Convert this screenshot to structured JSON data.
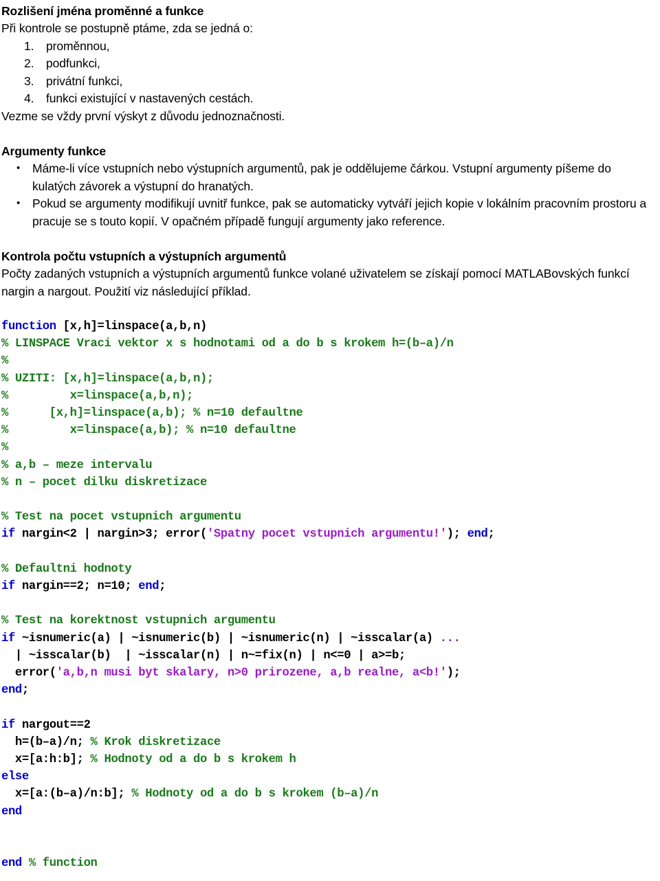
{
  "colors": {
    "keyword": "#0000CC",
    "comment": "#1B7A1B",
    "string": "#9A1FC4",
    "plain": "#000000",
    "background": "#FFFFFF"
  },
  "sections": {
    "s1": {
      "heading": "Rozlišení jména proměnné a funkce",
      "intro": "Při kontrole se postupně ptáme, zda se jedná o:",
      "items": [
        {
          "num": "1.",
          "text": "proměnnou,"
        },
        {
          "num": "2.",
          "text": "podfunkci,"
        },
        {
          "num": "3.",
          "text": "privátní funkci,"
        },
        {
          "num": "4.",
          "text": "funkci existující v nastavených cestách."
        }
      ],
      "closing": "Vezme se vždy první výskyt z důvodu jednoznačnosti."
    },
    "s2": {
      "heading": "Argumenty funkce",
      "bullet": "•",
      "items": [
        "Máme-li více vstupních nebo výstupních argumentů, pak je oddělujeme čárkou. Vstupní argumenty píšeme do kulatých závorek a výstupní do hranatých.",
        "Pokud se argumenty modifikují uvnitř funkce, pak se automaticky vytváří jejich kopie v lokálním pracovním prostoru a pracuje se s touto kopií. V opačném případě fungují argumenty jako reference."
      ]
    },
    "s3": {
      "heading": "Kontrola počtu vstupních a výstupních argumentů",
      "para": "Počty zadaných vstupních a výstupních argumentů funkce volané uživatelem se získají pomocí MATLABovských funkcí nargin a nargout. Použití viz následující příklad."
    }
  },
  "code": {
    "language": "matlab",
    "lines": [
      {
        "id": "l01",
        "parts": [
          {
            "c": "kw",
            "t": "function"
          },
          {
            "c": "plain",
            "t": " [x,h]=linspace(a,b,n)"
          }
        ]
      },
      {
        "id": "l02",
        "parts": [
          {
            "c": "cmt",
            "t": "% LINSPACE Vraci vektor x s hodnotami od a do b s krokem h=(b–a)/n"
          }
        ]
      },
      {
        "id": "l03",
        "parts": [
          {
            "c": "cmt",
            "t": "%"
          }
        ]
      },
      {
        "id": "l04",
        "parts": [
          {
            "c": "cmt",
            "t": "% UZITI: [x,h]=linspace(a,b,n);"
          }
        ]
      },
      {
        "id": "l05",
        "parts": [
          {
            "c": "cmt",
            "t": "%         x=linspace(a,b,n);"
          }
        ]
      },
      {
        "id": "l06",
        "parts": [
          {
            "c": "cmt",
            "t": "%      [x,h]=linspace(a,b); % n=10 defaultne"
          }
        ]
      },
      {
        "id": "l07",
        "parts": [
          {
            "c": "cmt",
            "t": "%         x=linspace(a,b); % n=10 defaultne"
          }
        ]
      },
      {
        "id": "l08",
        "parts": [
          {
            "c": "cmt",
            "t": "%"
          }
        ]
      },
      {
        "id": "l09",
        "parts": [
          {
            "c": "cmt",
            "t": "% a,b – meze intervalu"
          }
        ]
      },
      {
        "id": "l10",
        "parts": [
          {
            "c": "cmt",
            "t": "% n – pocet dilku diskretizace"
          }
        ]
      },
      {
        "id": "l11",
        "parts": [
          {
            "c": "plain",
            "t": ""
          }
        ]
      },
      {
        "id": "l12",
        "parts": [
          {
            "c": "cmt",
            "t": "% Test na pocet vstupnich argumentu"
          }
        ]
      },
      {
        "id": "l13",
        "parts": [
          {
            "c": "kw",
            "t": "if"
          },
          {
            "c": "plain",
            "t": " nargin<2 | nargin>3; error("
          },
          {
            "c": "str",
            "t": "'Spatny pocet vstupnich argumentu!'"
          },
          {
            "c": "plain",
            "t": "); "
          },
          {
            "c": "kw",
            "t": "end"
          },
          {
            "c": "plain",
            "t": ";"
          }
        ]
      },
      {
        "id": "l14",
        "parts": [
          {
            "c": "plain",
            "t": ""
          }
        ]
      },
      {
        "id": "l15",
        "parts": [
          {
            "c": "cmt",
            "t": "% Defaultni hodnoty"
          }
        ]
      },
      {
        "id": "l16",
        "parts": [
          {
            "c": "kw",
            "t": "if"
          },
          {
            "c": "plain",
            "t": " nargin==2; n=10; "
          },
          {
            "c": "kw",
            "t": "end"
          },
          {
            "c": "plain",
            "t": ";"
          }
        ]
      },
      {
        "id": "l17",
        "parts": [
          {
            "c": "plain",
            "t": ""
          }
        ]
      },
      {
        "id": "l18",
        "parts": [
          {
            "c": "cmt",
            "t": "% Test na korektnost vstupnich argumentu"
          }
        ]
      },
      {
        "id": "l19",
        "parts": [
          {
            "c": "kw",
            "t": "if"
          },
          {
            "c": "plain",
            "t": " ~isnumeric(a) | ~isnumeric(b) | ~isnumeric(n) | ~isscalar(a) "
          },
          {
            "c": "ell",
            "t": "..."
          }
        ]
      },
      {
        "id": "l20",
        "parts": [
          {
            "c": "plain",
            "t": "  | ~isscalar(b)  | ~isscalar(n) | n~=fix(n) | n<=0 | a>=b;"
          }
        ]
      },
      {
        "id": "l21",
        "parts": [
          {
            "c": "plain",
            "t": "  error("
          },
          {
            "c": "str",
            "t": "'a,b,n musi byt skalary, n>0 prirozene, a,b realne, a<b!'"
          },
          {
            "c": "plain",
            "t": ");"
          }
        ]
      },
      {
        "id": "l22",
        "parts": [
          {
            "c": "kw",
            "t": "end"
          },
          {
            "c": "plain",
            "t": ";"
          }
        ]
      },
      {
        "id": "l23",
        "parts": [
          {
            "c": "plain",
            "t": ""
          }
        ]
      },
      {
        "id": "l24",
        "parts": [
          {
            "c": "kw",
            "t": "if"
          },
          {
            "c": "plain",
            "t": " nargout==2"
          }
        ]
      },
      {
        "id": "l25",
        "parts": [
          {
            "c": "plain",
            "t": "  h=(b–a)/n; "
          },
          {
            "c": "cmt",
            "t": "% Krok diskretizace"
          }
        ]
      },
      {
        "id": "l26",
        "parts": [
          {
            "c": "plain",
            "t": "  x=[a:h:b]; "
          },
          {
            "c": "cmt",
            "t": "% Hodnoty od a do b s krokem h"
          }
        ]
      },
      {
        "id": "l27",
        "parts": [
          {
            "c": "kw",
            "t": "else"
          }
        ]
      },
      {
        "id": "l28",
        "parts": [
          {
            "c": "plain",
            "t": "  x=[a:(b–a)/n:b]; "
          },
          {
            "c": "cmt",
            "t": "% Hodnoty od a do b s krokem (b–a)/n"
          }
        ]
      },
      {
        "id": "l29",
        "parts": [
          {
            "c": "kw",
            "t": "end"
          }
        ]
      },
      {
        "id": "l30",
        "parts": [
          {
            "c": "plain",
            "t": ""
          }
        ]
      },
      {
        "id": "l31",
        "parts": [
          {
            "c": "plain",
            "t": ""
          }
        ]
      },
      {
        "id": "l32",
        "parts": [
          {
            "c": "kw",
            "t": "end"
          },
          {
            "c": "plain",
            "t": " "
          },
          {
            "c": "cmt",
            "t": "% function"
          }
        ]
      }
    ]
  }
}
